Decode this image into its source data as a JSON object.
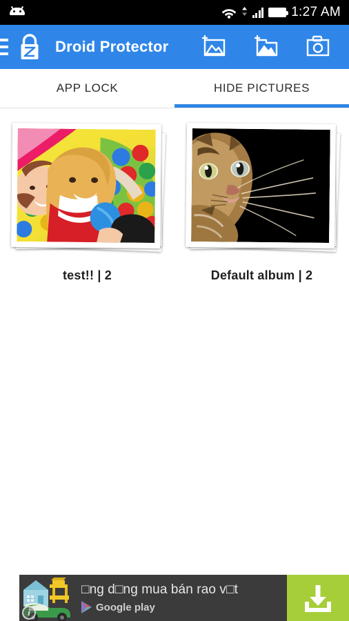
{
  "status_bar": {
    "notification_icon": "android-robot-icon",
    "icons": [
      "wifi-icon",
      "cellular-signal-icon",
      "battery-icon"
    ],
    "time": "1:27 AM",
    "background_color": "#000000"
  },
  "app_bar": {
    "menu_icon": "hamburger-menu-icon",
    "logo_icon": "padlock-icon",
    "title": "Droid Protector",
    "background_color": "#2f86e8",
    "actions": [
      {
        "icon": "add-picture-icon",
        "label": "Add picture"
      },
      {
        "icon": "add-album-icon",
        "label": "Add album"
      },
      {
        "icon": "camera-icon",
        "label": "Camera"
      }
    ]
  },
  "tabs": {
    "items": [
      {
        "label": "APP LOCK",
        "active": false
      },
      {
        "label": "HIDE PICTURES",
        "active": true
      }
    ],
    "active_index": 1,
    "indicator_color": "#2f86e8"
  },
  "albums": [
    {
      "name": "test!!",
      "count": "2",
      "label": "test!! | 2",
      "thumbnail": "children-playing-in-ball-pit-photo"
    },
    {
      "name": "Default album",
      "count": "2",
      "label": "Default album | 2",
      "thumbnail": "tabby-kitten-on-black-background-photo"
    }
  ],
  "ad_banner": {
    "thumbnail_icon": "house-car-furniture-illustration",
    "info_badge": "i",
    "headline": "□ng d□ng mua bán rao v□t",
    "store_icon": "google-play-icon",
    "store_label": "Google play",
    "cta_icon": "download-icon",
    "cta_color": "#a6ce39",
    "background_color": "#3b3b3b"
  }
}
